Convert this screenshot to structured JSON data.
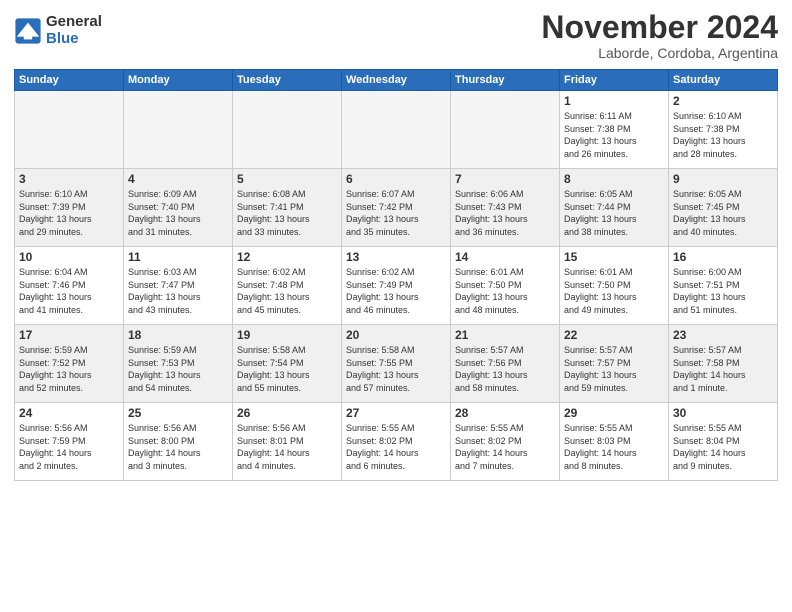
{
  "logo": {
    "general": "General",
    "blue": "Blue"
  },
  "title": "November 2024",
  "location": "Laborde, Cordoba, Argentina",
  "weekdays": [
    "Sunday",
    "Monday",
    "Tuesday",
    "Wednesday",
    "Thursday",
    "Friday",
    "Saturday"
  ],
  "weeks": [
    [
      {
        "day": "",
        "empty": true
      },
      {
        "day": "",
        "empty": true
      },
      {
        "day": "",
        "empty": true
      },
      {
        "day": "",
        "empty": true
      },
      {
        "day": "",
        "empty": true
      },
      {
        "day": "1",
        "lines": [
          "Sunrise: 6:11 AM",
          "Sunset: 7:38 PM",
          "Daylight: 13 hours",
          "and 26 minutes."
        ]
      },
      {
        "day": "2",
        "lines": [
          "Sunrise: 6:10 AM",
          "Sunset: 7:38 PM",
          "Daylight: 13 hours",
          "and 28 minutes."
        ]
      }
    ],
    [
      {
        "day": "3",
        "lines": [
          "Sunrise: 6:10 AM",
          "Sunset: 7:39 PM",
          "Daylight: 13 hours",
          "and 29 minutes."
        ]
      },
      {
        "day": "4",
        "lines": [
          "Sunrise: 6:09 AM",
          "Sunset: 7:40 PM",
          "Daylight: 13 hours",
          "and 31 minutes."
        ]
      },
      {
        "day": "5",
        "lines": [
          "Sunrise: 6:08 AM",
          "Sunset: 7:41 PM",
          "Daylight: 13 hours",
          "and 33 minutes."
        ]
      },
      {
        "day": "6",
        "lines": [
          "Sunrise: 6:07 AM",
          "Sunset: 7:42 PM",
          "Daylight: 13 hours",
          "and 35 minutes."
        ]
      },
      {
        "day": "7",
        "lines": [
          "Sunrise: 6:06 AM",
          "Sunset: 7:43 PM",
          "Daylight: 13 hours",
          "and 36 minutes."
        ]
      },
      {
        "day": "8",
        "lines": [
          "Sunrise: 6:05 AM",
          "Sunset: 7:44 PM",
          "Daylight: 13 hours",
          "and 38 minutes."
        ]
      },
      {
        "day": "9",
        "lines": [
          "Sunrise: 6:05 AM",
          "Sunset: 7:45 PM",
          "Daylight: 13 hours",
          "and 40 minutes."
        ]
      }
    ],
    [
      {
        "day": "10",
        "lines": [
          "Sunrise: 6:04 AM",
          "Sunset: 7:46 PM",
          "Daylight: 13 hours",
          "and 41 minutes."
        ]
      },
      {
        "day": "11",
        "lines": [
          "Sunrise: 6:03 AM",
          "Sunset: 7:47 PM",
          "Daylight: 13 hours",
          "and 43 minutes."
        ]
      },
      {
        "day": "12",
        "lines": [
          "Sunrise: 6:02 AM",
          "Sunset: 7:48 PM",
          "Daylight: 13 hours",
          "and 45 minutes."
        ]
      },
      {
        "day": "13",
        "lines": [
          "Sunrise: 6:02 AM",
          "Sunset: 7:49 PM",
          "Daylight: 13 hours",
          "and 46 minutes."
        ]
      },
      {
        "day": "14",
        "lines": [
          "Sunrise: 6:01 AM",
          "Sunset: 7:50 PM",
          "Daylight: 13 hours",
          "and 48 minutes."
        ]
      },
      {
        "day": "15",
        "lines": [
          "Sunrise: 6:01 AM",
          "Sunset: 7:50 PM",
          "Daylight: 13 hours",
          "and 49 minutes."
        ]
      },
      {
        "day": "16",
        "lines": [
          "Sunrise: 6:00 AM",
          "Sunset: 7:51 PM",
          "Daylight: 13 hours",
          "and 51 minutes."
        ]
      }
    ],
    [
      {
        "day": "17",
        "lines": [
          "Sunrise: 5:59 AM",
          "Sunset: 7:52 PM",
          "Daylight: 13 hours",
          "and 52 minutes."
        ]
      },
      {
        "day": "18",
        "lines": [
          "Sunrise: 5:59 AM",
          "Sunset: 7:53 PM",
          "Daylight: 13 hours",
          "and 54 minutes."
        ]
      },
      {
        "day": "19",
        "lines": [
          "Sunrise: 5:58 AM",
          "Sunset: 7:54 PM",
          "Daylight: 13 hours",
          "and 55 minutes."
        ]
      },
      {
        "day": "20",
        "lines": [
          "Sunrise: 5:58 AM",
          "Sunset: 7:55 PM",
          "Daylight: 13 hours",
          "and 57 minutes."
        ]
      },
      {
        "day": "21",
        "lines": [
          "Sunrise: 5:57 AM",
          "Sunset: 7:56 PM",
          "Daylight: 13 hours",
          "and 58 minutes."
        ]
      },
      {
        "day": "22",
        "lines": [
          "Sunrise: 5:57 AM",
          "Sunset: 7:57 PM",
          "Daylight: 13 hours",
          "and 59 minutes."
        ]
      },
      {
        "day": "23",
        "lines": [
          "Sunrise: 5:57 AM",
          "Sunset: 7:58 PM",
          "Daylight: 14 hours",
          "and 1 minute."
        ]
      }
    ],
    [
      {
        "day": "24",
        "lines": [
          "Sunrise: 5:56 AM",
          "Sunset: 7:59 PM",
          "Daylight: 14 hours",
          "and 2 minutes."
        ]
      },
      {
        "day": "25",
        "lines": [
          "Sunrise: 5:56 AM",
          "Sunset: 8:00 PM",
          "Daylight: 14 hours",
          "and 3 minutes."
        ]
      },
      {
        "day": "26",
        "lines": [
          "Sunrise: 5:56 AM",
          "Sunset: 8:01 PM",
          "Daylight: 14 hours",
          "and 4 minutes."
        ]
      },
      {
        "day": "27",
        "lines": [
          "Sunrise: 5:55 AM",
          "Sunset: 8:02 PM",
          "Daylight: 14 hours",
          "and 6 minutes."
        ]
      },
      {
        "day": "28",
        "lines": [
          "Sunrise: 5:55 AM",
          "Sunset: 8:02 PM",
          "Daylight: 14 hours",
          "and 7 minutes."
        ]
      },
      {
        "day": "29",
        "lines": [
          "Sunrise: 5:55 AM",
          "Sunset: 8:03 PM",
          "Daylight: 14 hours",
          "and 8 minutes."
        ]
      },
      {
        "day": "30",
        "lines": [
          "Sunrise: 5:55 AM",
          "Sunset: 8:04 PM",
          "Daylight: 14 hours",
          "and 9 minutes."
        ]
      }
    ]
  ]
}
